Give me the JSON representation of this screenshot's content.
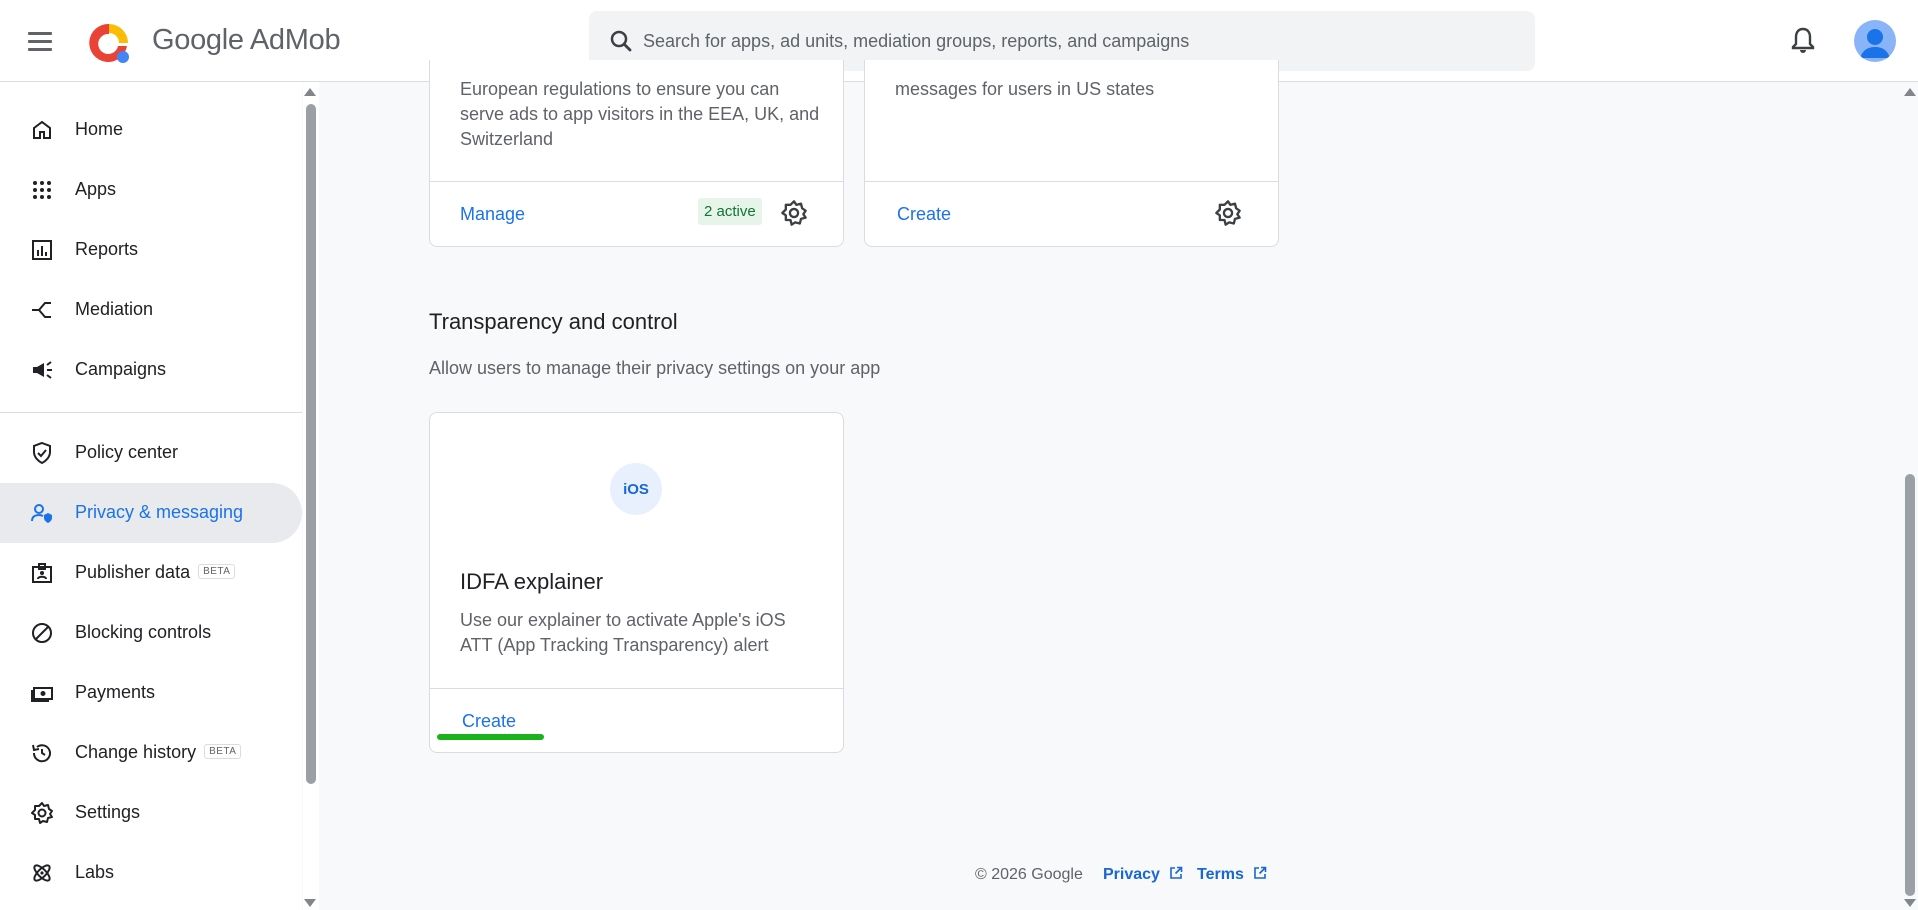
{
  "header": {
    "brand_google": "Google",
    "brand_product": "AdMob",
    "search_placeholder": "Search for apps, ad units, mediation groups, reports, and campaigns"
  },
  "sidebar": {
    "items": [
      {
        "label": "Home",
        "icon": "home-icon"
      },
      {
        "label": "Apps",
        "icon": "apps-grid-icon"
      },
      {
        "label": "Reports",
        "icon": "reports-icon"
      },
      {
        "label": "Mediation",
        "icon": "mediation-icon"
      },
      {
        "label": "Campaigns",
        "icon": "campaigns-icon"
      },
      {
        "label": "Policy center",
        "icon": "policy-shield-icon"
      },
      {
        "label": "Privacy & messaging",
        "icon": "privacy-user-icon",
        "active": true
      },
      {
        "label": "Publisher data",
        "icon": "publisher-data-icon",
        "badge": "BETA"
      },
      {
        "label": "Blocking controls",
        "icon": "blocking-icon"
      },
      {
        "label": "Payments",
        "icon": "payments-icon"
      },
      {
        "label": "Change history",
        "icon": "history-icon",
        "badge": "BETA"
      },
      {
        "label": "Settings",
        "icon": "settings-gear-icon"
      },
      {
        "label": "Labs",
        "icon": "labs-icon"
      }
    ]
  },
  "cards_top": {
    "gdpr": {
      "description_lines": [
        "European regulations to ensure you can",
        "serve ads to app visitors in the EEA, UK, and",
        "Switzerland"
      ],
      "action_label": "Manage",
      "status_badge": "2 active"
    },
    "us_states": {
      "description_lines": [
        "messages for users in US states"
      ],
      "action_label": "Create"
    }
  },
  "section": {
    "title": "Transparency and control",
    "description": "Allow users to manage their privacy settings on your app"
  },
  "idfa_card": {
    "icon_text": "iOS",
    "title": "IDFA explainer",
    "description_lines": [
      "Use our explainer to activate Apple's iOS",
      "ATT (App Tracking Transparency) alert"
    ],
    "action_label": "Create"
  },
  "footer": {
    "copyright": "© 2026 Google",
    "privacy_label": "Privacy",
    "terms_label": "Terms"
  },
  "colors": {
    "accent": "#1a73e8",
    "active_badge_bg": "#e6f4ea",
    "active_badge_text": "#137333",
    "annotation_underline": "#1bb31b"
  }
}
